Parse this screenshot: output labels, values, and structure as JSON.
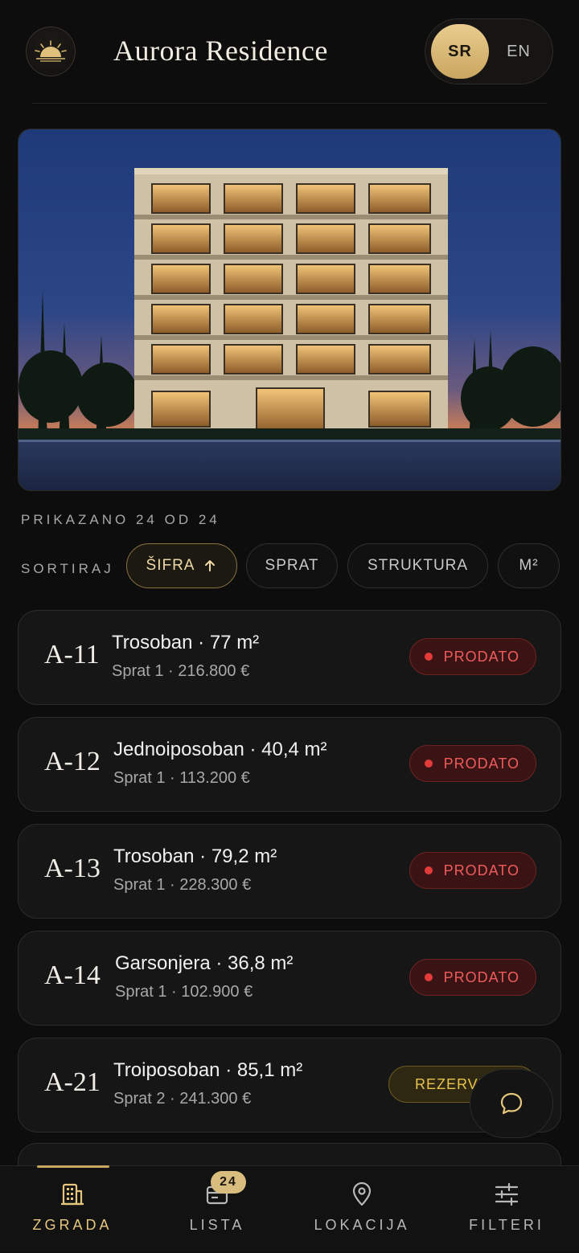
{
  "header": {
    "logo_icon": "sunrise-icon",
    "title": "Aurora Residence",
    "languages": [
      {
        "code": "SR",
        "active": true
      },
      {
        "code": "EN",
        "active": false
      }
    ]
  },
  "hero": {
    "image": "night-building-photo"
  },
  "listing": {
    "shown_text": "PRIKAZANO 24 OD 24",
    "sort_label": "SORTIRAJ",
    "sort_options": [
      {
        "label": "ŠIFRA",
        "active": true,
        "icon": "arrow-up-icon"
      },
      {
        "label": "SPRAT",
        "active": false
      },
      {
        "label": "STRUKTURA",
        "active": false
      },
      {
        "label": "M²",
        "active": false
      }
    ],
    "units": [
      {
        "code": "A-11",
        "title": "Trosoban · 77 m²",
        "sub": "Sprat 1 · 216.800 €",
        "status": "PRODATO"
      },
      {
        "code": "A-12",
        "title": "Jednoiposoban · 40,4 m²",
        "sub": "Sprat 1 · 113.200 €",
        "status": "PRODATO"
      },
      {
        "code": "A-13",
        "title": "Trosoban · 79,2 m²",
        "sub": "Sprat 1 · 228.300 €",
        "status": "PRODATO"
      },
      {
        "code": "A-14",
        "title": "Garsonjera · 36,8 m²",
        "sub": "Sprat 1 · 102.900 €",
        "status": "PRODATO"
      },
      {
        "code": "A-21",
        "title": "Troiposoban · 85,1 m²",
        "sub": "Sprat 2 · 241.300 €",
        "status": "REZERVISANO"
      }
    ]
  },
  "chat": {
    "icon": "chat-bubble-icon"
  },
  "bottom_nav": {
    "items": [
      {
        "label": "ZGRADA",
        "icon": "building-icon",
        "active": true
      },
      {
        "label": "LISTA",
        "icon": "list-card-icon",
        "badge": "24",
        "active": false
      },
      {
        "label": "LOKACIJA",
        "icon": "location-pin-icon",
        "active": false
      },
      {
        "label": "FILTERI",
        "icon": "sliders-icon",
        "active": false
      }
    ]
  },
  "colors": {
    "accent_gold": "#c9a660",
    "sold_red": "#e33a3a",
    "reserved_yellow": "#e8b820",
    "background": "#0d0d0d"
  }
}
